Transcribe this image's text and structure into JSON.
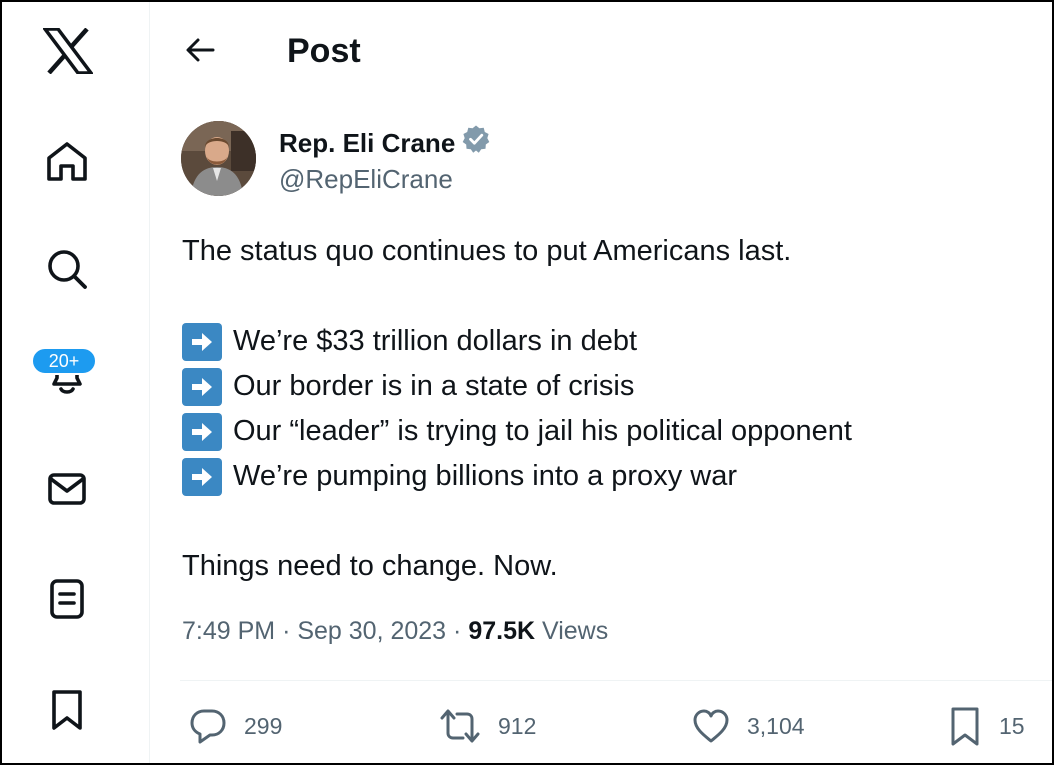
{
  "sidebar": {
    "items": [
      {
        "name": "x-logo-icon"
      },
      {
        "name": "home-icon"
      },
      {
        "name": "search-icon"
      },
      {
        "name": "notifications-icon"
      },
      {
        "name": "messages-icon"
      },
      {
        "name": "lists-icon"
      },
      {
        "name": "bookmarks-icon"
      }
    ],
    "notification_badge": "20+"
  },
  "header": {
    "title": "Post"
  },
  "post": {
    "author": {
      "name": "Rep. Eli Crane",
      "handle": "@RepEliCrane",
      "verified": true
    },
    "lines": {
      "intro": "The status quo continues to put Americans last.",
      "bullet1": "We’re $33 trillion dollars in debt",
      "bullet2": "Our border is in a state of crisis",
      "bullet3": "Our “leader” is trying to jail his political opponent",
      "bullet4": "We’re pumping billions into a proxy war",
      "closing": "Things need to change. Now."
    },
    "meta": {
      "time": "7:49 PM",
      "separator": "·",
      "date": "Sep 30, 2023",
      "views_count": "97.5K",
      "views_label": "Views"
    },
    "actions": {
      "replies": "299",
      "reposts": "912",
      "likes": "3,104",
      "bookmarks": "15"
    }
  },
  "colors": {
    "accent": "#1d9bf0",
    "text_primary": "#0f1419",
    "text_secondary": "#536471",
    "verified_badge": "#829aab",
    "arrow_emoji_bg": "#3b88c3"
  }
}
